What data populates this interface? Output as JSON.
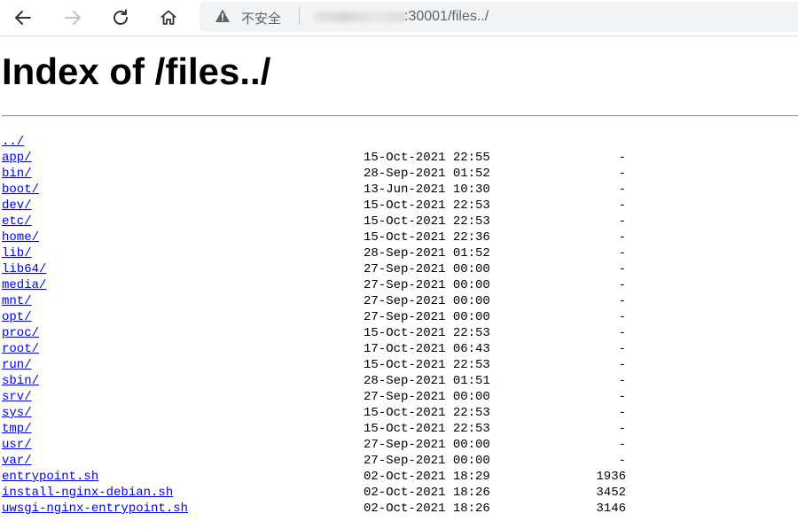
{
  "browser": {
    "address_security_label": "不安全",
    "address_url": ":30001/files../"
  },
  "page": {
    "title": "Index of /files../",
    "parent_link": "../",
    "entries": [
      {
        "name": "app/",
        "date": "15-Oct-2021 22:55",
        "size": "-"
      },
      {
        "name": "bin/",
        "date": "28-Sep-2021 01:52",
        "size": "-"
      },
      {
        "name": "boot/",
        "date": "13-Jun-2021 10:30",
        "size": "-"
      },
      {
        "name": "dev/",
        "date": "15-Oct-2021 22:53",
        "size": "-"
      },
      {
        "name": "etc/",
        "date": "15-Oct-2021 22:53",
        "size": "-"
      },
      {
        "name": "home/",
        "date": "15-Oct-2021 22:36",
        "size": "-"
      },
      {
        "name": "lib/",
        "date": "28-Sep-2021 01:52",
        "size": "-"
      },
      {
        "name": "lib64/",
        "date": "27-Sep-2021 00:00",
        "size": "-"
      },
      {
        "name": "media/",
        "date": "27-Sep-2021 00:00",
        "size": "-"
      },
      {
        "name": "mnt/",
        "date": "27-Sep-2021 00:00",
        "size": "-"
      },
      {
        "name": "opt/",
        "date": "27-Sep-2021 00:00",
        "size": "-"
      },
      {
        "name": "proc/",
        "date": "15-Oct-2021 22:53",
        "size": "-"
      },
      {
        "name": "root/",
        "date": "17-Oct-2021 06:43",
        "size": "-"
      },
      {
        "name": "run/",
        "date": "15-Oct-2021 22:53",
        "size": "-"
      },
      {
        "name": "sbin/",
        "date": "28-Sep-2021 01:51",
        "size": "-"
      },
      {
        "name": "srv/",
        "date": "27-Sep-2021 00:00",
        "size": "-"
      },
      {
        "name": "sys/",
        "date": "15-Oct-2021 22:53",
        "size": "-"
      },
      {
        "name": "tmp/",
        "date": "15-Oct-2021 22:53",
        "size": "-"
      },
      {
        "name": "usr/",
        "date": "27-Sep-2021 00:00",
        "size": "-"
      },
      {
        "name": "var/",
        "date": "27-Sep-2021 00:00",
        "size": "-"
      },
      {
        "name": "entrypoint.sh",
        "date": "02-Oct-2021 18:29",
        "size": "1936"
      },
      {
        "name": "install-nginx-debian.sh",
        "date": "02-Oct-2021 18:26",
        "size": "3452"
      },
      {
        "name": "uwsgi-nginx-entrypoint.sh",
        "date": "02-Oct-2021 18:26",
        "size": "3146"
      }
    ]
  }
}
